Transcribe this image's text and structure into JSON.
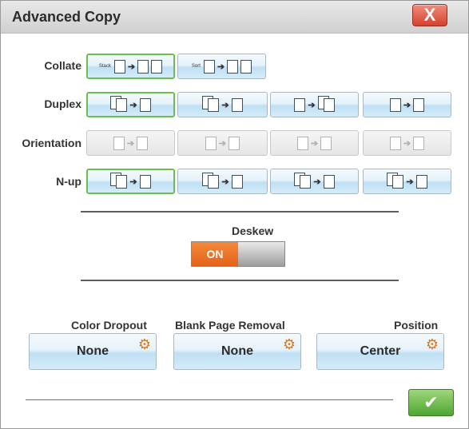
{
  "window": {
    "title": "Advanced Copy",
    "close_glyph": "X"
  },
  "rows": {
    "collate": {
      "label": "Collate",
      "options": [
        {
          "tag": "Stack"
        },
        {
          "tag": "Sort"
        }
      ]
    },
    "duplex": {
      "label": "Duplex"
    },
    "orientation": {
      "label": "Orientation"
    },
    "nup": {
      "label": "N-up"
    }
  },
  "deskew": {
    "label": "Deskew",
    "state": "ON"
  },
  "options": {
    "color_dropout": {
      "label": "Color Dropout",
      "value": "None"
    },
    "blank_page_removal": {
      "label": "Blank Page Removal",
      "value": "None"
    },
    "position": {
      "label": "Position",
      "value": "Center"
    }
  },
  "ok": {
    "glyph": "✔"
  },
  "colors": {
    "selected_border": "#6cbf4c",
    "toggle_on": "#e3621a",
    "ok_green": "#4ea532",
    "close_red": "#d3422e"
  },
  "icons": [
    "page-icon",
    "arrow-icon",
    "gear-icon",
    "check-icon",
    "close-icon"
  ]
}
